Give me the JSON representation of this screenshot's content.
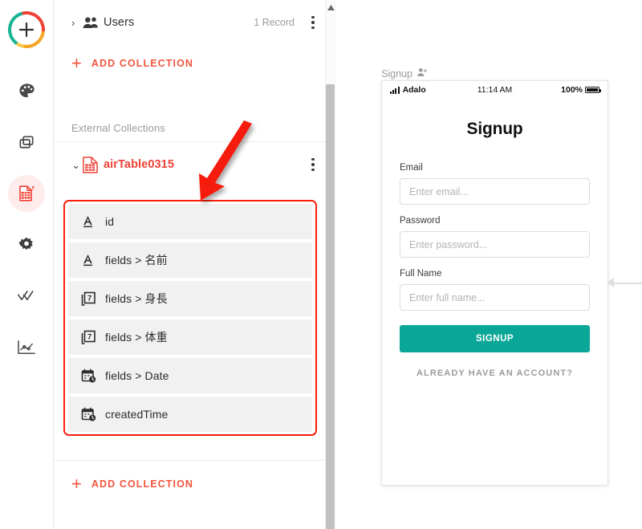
{
  "rail": {
    "add_button": {
      "name": "add-new",
      "label": "+"
    },
    "items": [
      {
        "name": "design-palette",
        "icon": "palette-icon",
        "active": false
      },
      {
        "name": "screens",
        "icon": "screens-icon",
        "active": false
      },
      {
        "name": "database",
        "icon": "database-icon",
        "active": true
      },
      {
        "name": "settings",
        "icon": "gear-icon",
        "active": false
      },
      {
        "name": "publish",
        "icon": "double-check-icon",
        "active": false
      },
      {
        "name": "analytics",
        "icon": "analytics-icon",
        "active": false
      }
    ]
  },
  "panel": {
    "collections": [
      {
        "label": "Users",
        "count": "1 Record",
        "icon": "users-icon",
        "expanded": false
      }
    ],
    "add_collection_top": "ADD COLLECTION",
    "section_heading": "External Collections",
    "external": {
      "label": "airTable0315",
      "icon": "airtable-sheet-icon",
      "expanded": true,
      "fields": [
        {
          "label": "id",
          "type": "text",
          "icon": "text-type-icon"
        },
        {
          "label": "fields > 名前",
          "type": "text",
          "icon": "text-type-icon"
        },
        {
          "label": "fields > 身長",
          "type": "number",
          "icon": "number-type-icon"
        },
        {
          "label": "fields > 体重",
          "type": "number",
          "icon": "number-type-icon"
        },
        {
          "label": "fields > Date",
          "type": "datetime",
          "icon": "date-type-icon"
        },
        {
          "label": "createdTime",
          "type": "datetime",
          "icon": "date-type-icon"
        }
      ]
    },
    "add_collection_bottom": "ADD COLLECTION",
    "highlight_color": "#fb1e0a"
  },
  "canvas": {
    "screen_label": "Signup",
    "screen_label_icon": "person-add-icon",
    "phone": {
      "status_bar": {
        "carrier": "Adalo",
        "time": "11:14 AM",
        "battery": "100%"
      },
      "title": "Signup",
      "fields": [
        {
          "label": "Email",
          "placeholder": "Enter email..."
        },
        {
          "label": "Password",
          "placeholder": "Enter password..."
        },
        {
          "label": "Full Name",
          "placeholder": "Enter full name..."
        }
      ],
      "primary_button": "SIGNUP",
      "alt_link": "ALREADY HAVE AN ACCOUNT?",
      "accent_color": "#0aa697"
    }
  },
  "scrollbar": {
    "name": "panel-scrollbar"
  }
}
